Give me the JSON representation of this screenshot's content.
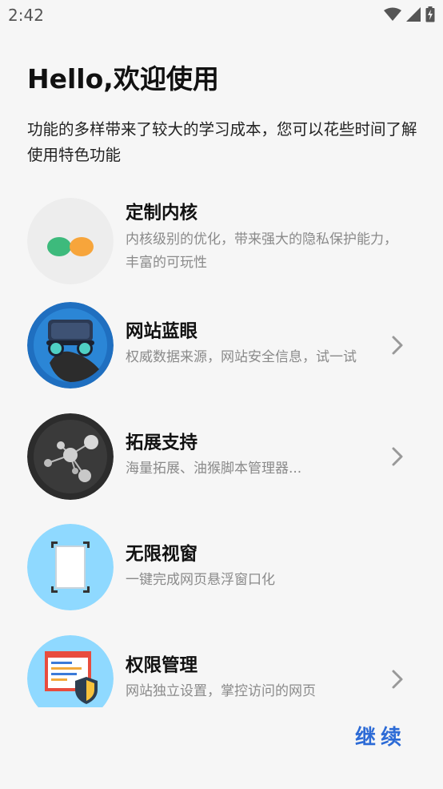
{
  "status_bar": {
    "time": "2:42",
    "icons": [
      "wifi-icon",
      "signal-icon",
      "battery-charging-icon"
    ]
  },
  "title": "Hello,欢迎使用",
  "intro": "功能的多样带来了较大的学习成本，您可以花些时间了解使用特色功能",
  "features": [
    {
      "title": "定制内核",
      "desc": "内核级别的优化，带来强大的隐私保护能力，丰富的可玩性",
      "icon": "kernel-icon",
      "has_chevron": false
    },
    {
      "title": "网站蓝眼",
      "desc": "权威数据来源，网站安全信息，试一试",
      "icon": "blue-eye-goggles-icon",
      "has_chevron": true
    },
    {
      "title": "拓展支持",
      "desc": "海量拓展、油猴脚本管理器...",
      "icon": "extension-molecule-icon",
      "has_chevron": true
    },
    {
      "title": "无限视窗",
      "desc": "一键完成网页悬浮窗口化",
      "icon": "floating-window-icon",
      "has_chevron": false
    },
    {
      "title": "权限管理",
      "desc": "网站独立设置，掌控访问的网页",
      "icon": "permission-shield-icon",
      "has_chevron": true
    }
  ],
  "continue_label": "继续",
  "colors": {
    "accent": "#2d6bd6",
    "background": "#f6f6f6",
    "muted_text": "#8a8a8a"
  }
}
